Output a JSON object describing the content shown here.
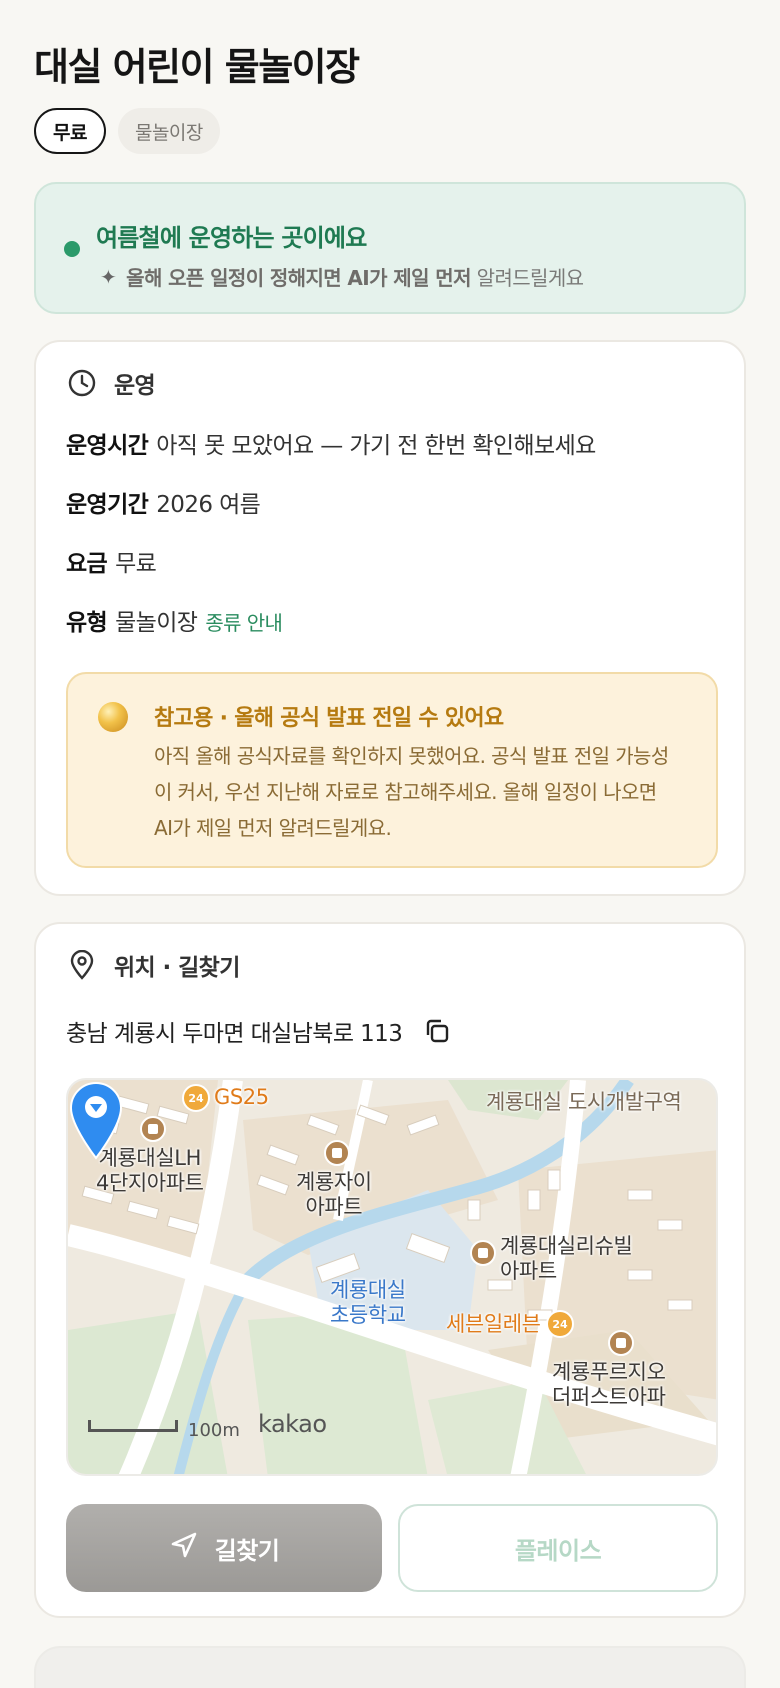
{
  "header": {
    "title": "대실 어린이 물놀이장",
    "chips": {
      "fee": "무료",
      "type": "물놀이장"
    }
  },
  "season": {
    "title": "여름철에 운영하는 곳이에요",
    "sub_bold": "올해 오픈 일정이 정해지면 AI가 제일 먼저",
    "sub_rest": "알려드릴게요"
  },
  "operation": {
    "heading": "운영",
    "rows": [
      {
        "key": "운영시간",
        "value": "아직 못 모았어요 — 가기 전 한번 확인해보세요"
      },
      {
        "key": "운영기간",
        "value": "2026 여름"
      },
      {
        "key": "요금",
        "value": "무료"
      },
      {
        "key": "유형",
        "value": "물놀이장",
        "link": "종류 안내"
      }
    ],
    "notice": {
      "title": "참고용 · 올해 공식 발표 전일 수 있어요",
      "body": "아직 올해 공식자료를 확인하지 못했어요. 공식 발표 전일 가능성이 커서, 우선 지난해 자료로 참고해주세요. 올해 일정이 나오면 AI가 제일 먼저 알려드릴게요."
    }
  },
  "location": {
    "heading": "위치 · 길찾기",
    "address": "충남 계룡시 두마면 대실남북로 113",
    "map": {
      "labels": {
        "gs25": "GS25",
        "district": "계룡대실 도시개발구역",
        "lh_apt": "계룡대실LH\n4단지아파트",
        "zai_apt": "계룡자이\n아파트",
        "school": "계룡대실\n초등학교",
        "richeville": "계룡대실리슈빌\n아파트",
        "seven": "세븐일레븐",
        "prugio": "계룡푸르지오\n더퍼스트아파"
      },
      "poi_24": "24",
      "scale": "100m",
      "brand": "kakao"
    },
    "buttons": {
      "route": "길찾기",
      "place": "플레이스"
    }
  },
  "colors": {
    "accent_green": "#1f7a52",
    "notice_gold": "#b57a10",
    "pin_blue": "#2f8cf0"
  }
}
